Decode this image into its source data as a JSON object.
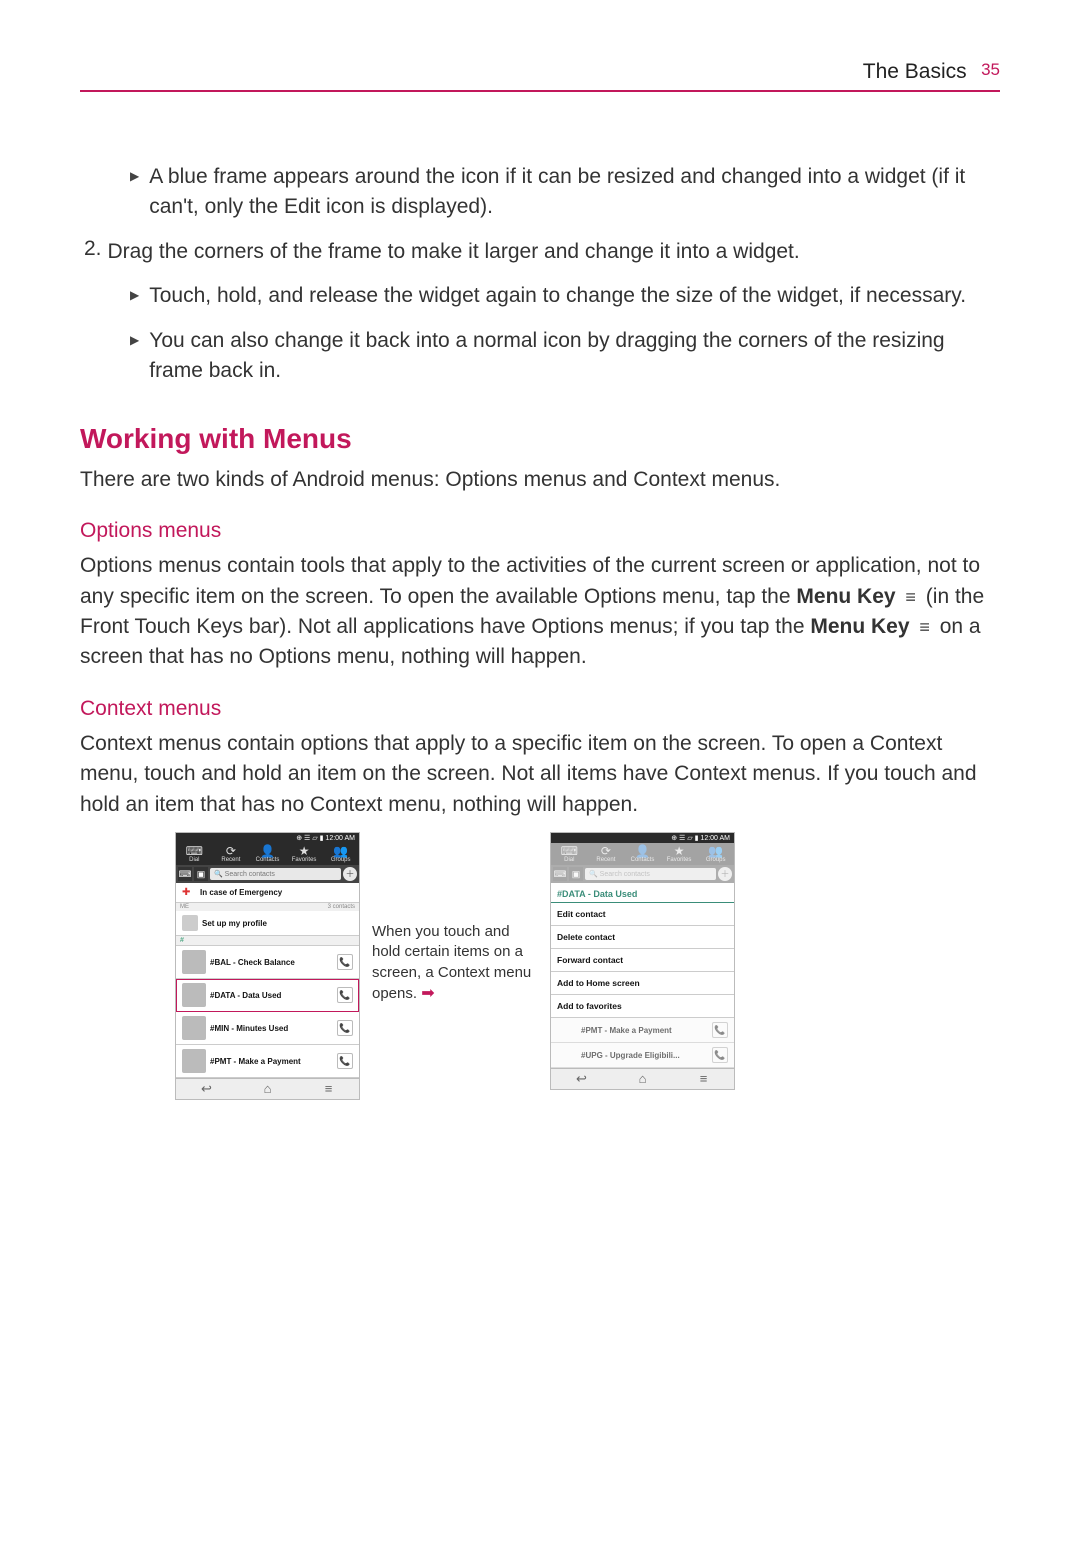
{
  "header": {
    "chapter": "The Basics",
    "page_number": "35"
  },
  "bullets": {
    "b1": "A blue frame appears around the icon if it can be resized and changed into a widget (if it can't, only the Edit icon is displayed).",
    "step2_num": "2.",
    "step2": "Drag the corners of the frame to make it larger and change it into a widget.",
    "b2": "Touch, hold, and release the widget again to change the size of the widget, if necessary.",
    "b3": "You can also change it back into a normal icon by dragging the corners of the resizing frame back in."
  },
  "section": {
    "title": "Working with Menus",
    "intro": "There are two kinds of Android menus: Options menus and Context menus."
  },
  "options": {
    "heading": "Options menus",
    "text_pre": "Options menus contain tools that apply to the activities of the current screen or application, not to any specific item on the screen. To open the available Options menu, tap the ",
    "menu_key": "Menu Key",
    "text_mid": " (in the Front Touch Keys bar). Not all applications have Options menus; if you tap the ",
    "text_end": " on a screen that has no Options menu, nothing will happen."
  },
  "context": {
    "heading": "Context menus",
    "text": "Context menus contain options that apply to a specific item on the screen. To open a Context menu, touch and hold an item on the screen. Not all items have Context menus. If you touch and hold an item that has no Context menu, nothing will happen."
  },
  "callout": {
    "text": "When you touch and hold certain items on a screen, a Context menu opens."
  },
  "phone_common": {
    "status_time": "12:00 AM",
    "status_icons": "⊕ ☰ ▱ ▮",
    "tabs": [
      "Dial",
      "Recent",
      "Contacts",
      "Favorites",
      "Groups"
    ],
    "tab_icons": [
      "⌨",
      "⟳",
      "👤",
      "★",
      "👥"
    ],
    "search_placeholder": "Search contacts",
    "nav_icons": [
      "↩",
      "⌂",
      "≡"
    ]
  },
  "phone1": {
    "emergency": "In case of Emergency",
    "me": "ME",
    "me_count": "3 contacts",
    "setup": "Set up my profile",
    "section_hash": "#",
    "contacts": [
      "#BAL - Check Balance",
      "#DATA - Data Used",
      "#MIN - Minutes Used",
      "#PMT - Make a Payment"
    ]
  },
  "phone2": {
    "menu_title": "#DATA - Data Used",
    "menu_items": [
      "Edit contact",
      "Delete contact",
      "Forward contact",
      "Add to Home screen",
      "Add to favorites"
    ],
    "bg_row1": "#PMT - Make a Payment",
    "bg_row2": "#UPG - Upgrade Eligibili..."
  }
}
